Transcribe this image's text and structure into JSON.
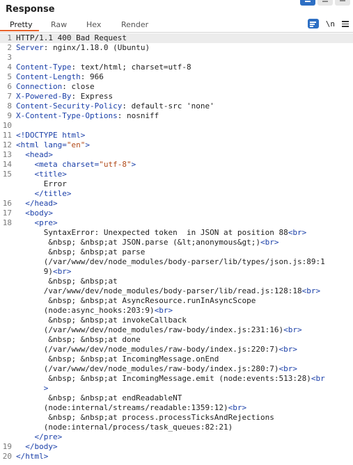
{
  "panel": {
    "title": "Response",
    "tabs": [
      "Pretty",
      "Raw",
      "Hex",
      "Render"
    ],
    "active_tab": "Pretty",
    "tools": {
      "newline_label": "\\n"
    },
    "accent_color": "#e8622a",
    "highlight_color": "#2d6fc4"
  },
  "lines": [
    {
      "n": "1",
      "segs": [
        {
          "t": "HTTP/1.1 400 Bad Request",
          "c": "txt"
        }
      ]
    },
    {
      "n": "2",
      "segs": [
        {
          "t": "Server",
          "c": "hname"
        },
        {
          "t": ": nginx/1.18.0 (Ubuntu)",
          "c": "txt"
        }
      ]
    },
    {
      "n": "3",
      "segs": []
    },
    {
      "n": "4",
      "segs": [
        {
          "t": "Content-Type",
          "c": "hname"
        },
        {
          "t": ": text/html; charset=utf-8",
          "c": "txt"
        }
      ]
    },
    {
      "n": "5",
      "segs": [
        {
          "t": "Content-Length",
          "c": "hname"
        },
        {
          "t": ": 966",
          "c": "txt"
        }
      ]
    },
    {
      "n": "6",
      "segs": [
        {
          "t": "Connection",
          "c": "hname"
        },
        {
          "t": ": close",
          "c": "txt"
        }
      ]
    },
    {
      "n": "7",
      "segs": [
        {
          "t": "X-Powered-By",
          "c": "hname"
        },
        {
          "t": ": Express",
          "c": "txt"
        }
      ]
    },
    {
      "n": "8",
      "segs": [
        {
          "t": "Content-Security-Policy",
          "c": "hname"
        },
        {
          "t": ": default-src 'none'",
          "c": "txt"
        }
      ]
    },
    {
      "n": "9",
      "segs": [
        {
          "t": "X-Content-Type-Options",
          "c": "hname"
        },
        {
          "t": ": nosniff",
          "c": "txt"
        }
      ]
    },
    {
      "n": "10",
      "segs": []
    },
    {
      "n": "11",
      "segs": [
        {
          "t": "<!DOCTYPE html>",
          "c": "tag"
        }
      ]
    },
    {
      "n": "12",
      "segs": [
        {
          "t": "<html ",
          "c": "tag"
        },
        {
          "t": "lang",
          "c": "attr"
        },
        {
          "t": "=",
          "c": "punct"
        },
        {
          "t": "\"en\"",
          "c": "aval"
        },
        {
          "t": ">",
          "c": "tag"
        }
      ]
    },
    {
      "n": "13",
      "segs": [
        {
          "t": "  <head>",
          "c": "tag"
        }
      ]
    },
    {
      "n": "14",
      "segs": [
        {
          "t": "    <meta ",
          "c": "tag"
        },
        {
          "t": "charset",
          "c": "attr"
        },
        {
          "t": "=",
          "c": "punct"
        },
        {
          "t": "\"utf-8\"",
          "c": "aval"
        },
        {
          "t": ">",
          "c": "tag"
        }
      ]
    },
    {
      "n": "15",
      "segs": [
        {
          "t": "    <title>",
          "c": "tag"
        }
      ]
    },
    {
      "n": "",
      "segs": [
        {
          "t": "      Error",
          "c": "txt"
        }
      ]
    },
    {
      "n": "",
      "segs": [
        {
          "t": "    </title>",
          "c": "tag"
        }
      ]
    },
    {
      "n": "16",
      "segs": [
        {
          "t": "  </head>",
          "c": "tag"
        }
      ]
    },
    {
      "n": "17",
      "segs": [
        {
          "t": "  <body>",
          "c": "tag"
        }
      ]
    },
    {
      "n": "18",
      "segs": [
        {
          "t": "    <pre>",
          "c": "tag"
        }
      ]
    },
    {
      "n": "",
      "segs": [
        {
          "t": "      SyntaxError: Unexpected token  in JSON at position 88",
          "c": "txt"
        },
        {
          "t": "<br>",
          "c": "tag"
        }
      ]
    },
    {
      "n": "",
      "segs": [
        {
          "t": "       &nbsp; &nbsp;at JSON.parse (&lt;anonymous&gt;)",
          "c": "txt"
        },
        {
          "t": "<br>",
          "c": "tag"
        }
      ]
    },
    {
      "n": "",
      "segs": [
        {
          "t": "       &nbsp; &nbsp;at parse",
          "c": "txt"
        }
      ]
    },
    {
      "n": "",
      "segs": [
        {
          "t": "      (/var/www/dev/node_modules/body-parser/lib/types/json.js:89:1",
          "c": "txt"
        }
      ]
    },
    {
      "n": "",
      "segs": [
        {
          "t": "      9)",
          "c": "txt"
        },
        {
          "t": "<br>",
          "c": "tag"
        }
      ]
    },
    {
      "n": "",
      "segs": [
        {
          "t": "       &nbsp; &nbsp;at",
          "c": "txt"
        }
      ]
    },
    {
      "n": "",
      "segs": [
        {
          "t": "      /var/www/dev/node_modules/body-parser/lib/read.js:128:18",
          "c": "txt"
        },
        {
          "t": "<br>",
          "c": "tag"
        }
      ]
    },
    {
      "n": "",
      "segs": [
        {
          "t": "       &nbsp; &nbsp;at AsyncResource.runInAsyncScope",
          "c": "txt"
        }
      ]
    },
    {
      "n": "",
      "segs": [
        {
          "t": "      (node:async_hooks:203:9)",
          "c": "txt"
        },
        {
          "t": "<br>",
          "c": "tag"
        }
      ]
    },
    {
      "n": "",
      "segs": [
        {
          "t": "       &nbsp; &nbsp;at invokeCallback",
          "c": "txt"
        }
      ]
    },
    {
      "n": "",
      "segs": [
        {
          "t": "      (/var/www/dev/node_modules/raw-body/index.js:231:16)",
          "c": "txt"
        },
        {
          "t": "<br>",
          "c": "tag"
        }
      ]
    },
    {
      "n": "",
      "segs": [
        {
          "t": "       &nbsp; &nbsp;at done",
          "c": "txt"
        }
      ]
    },
    {
      "n": "",
      "segs": [
        {
          "t": "      (/var/www/dev/node_modules/raw-body/index.js:220:7)",
          "c": "txt"
        },
        {
          "t": "<br>",
          "c": "tag"
        }
      ]
    },
    {
      "n": "",
      "segs": [
        {
          "t": "       &nbsp; &nbsp;at IncomingMessage.onEnd",
          "c": "txt"
        }
      ]
    },
    {
      "n": "",
      "segs": [
        {
          "t": "      (/var/www/dev/node_modules/raw-body/index.js:280:7)",
          "c": "txt"
        },
        {
          "t": "<br>",
          "c": "tag"
        }
      ]
    },
    {
      "n": "",
      "segs": [
        {
          "t": "       &nbsp; &nbsp;at IncomingMessage.emit (node:events:513:28)",
          "c": "txt"
        },
        {
          "t": "<br",
          "c": "tag"
        }
      ]
    },
    {
      "n": "",
      "segs": [
        {
          "t": "      >",
          "c": "tag"
        }
      ]
    },
    {
      "n": "",
      "segs": [
        {
          "t": "       &nbsp; &nbsp;at endReadableNT",
          "c": "txt"
        }
      ]
    },
    {
      "n": "",
      "segs": [
        {
          "t": "      (node:internal/streams/readable:1359:12)",
          "c": "txt"
        },
        {
          "t": "<br>",
          "c": "tag"
        }
      ]
    },
    {
      "n": "",
      "segs": [
        {
          "t": "       &nbsp; &nbsp;at process.processTicksAndRejections",
          "c": "txt"
        }
      ]
    },
    {
      "n": "",
      "segs": [
        {
          "t": "      (node:internal/process/task_queues:82:21)",
          "c": "txt"
        }
      ]
    },
    {
      "n": "",
      "segs": [
        {
          "t": "    </pre>",
          "c": "tag"
        }
      ]
    },
    {
      "n": "19",
      "segs": [
        {
          "t": "  </body>",
          "c": "tag"
        }
      ]
    },
    {
      "n": "20",
      "segs": [
        {
          "t": "</html>",
          "c": "tag"
        }
      ]
    }
  ]
}
